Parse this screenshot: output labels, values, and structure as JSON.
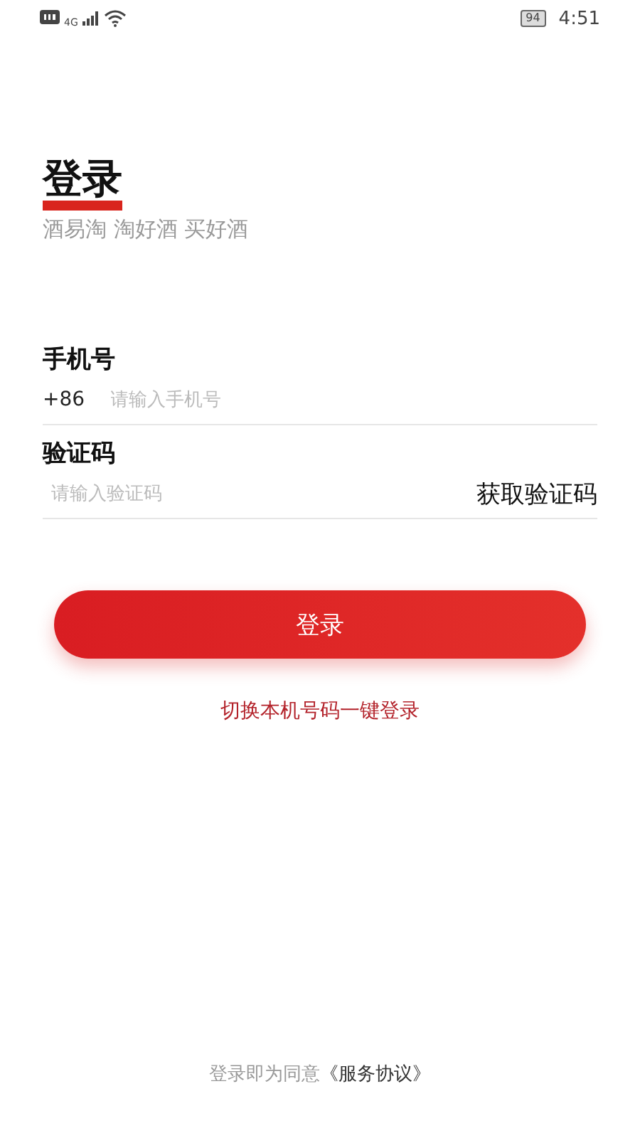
{
  "status_bar": {
    "network": "4G",
    "battery": "94",
    "time": "4:51"
  },
  "title": "登录",
  "slogan": "酒易淘 淘好酒 买好酒",
  "phone": {
    "label": "手机号",
    "prefix": "+86",
    "placeholder": "请输入手机号"
  },
  "code": {
    "label": "验证码",
    "placeholder": "请输入验证码",
    "action": "获取验证码"
  },
  "login_button": "登录",
  "switch_link": "切换本机号码一键登录",
  "agreement": {
    "text": "登录即为同意",
    "link": "《服务协议》"
  }
}
